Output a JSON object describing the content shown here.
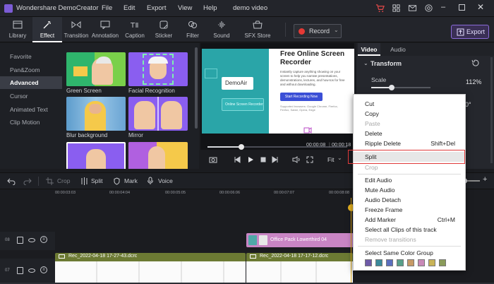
{
  "app": {
    "name": "Wondershare DemoCreator",
    "menus": [
      "File",
      "Edit",
      "Export",
      "View",
      "Help"
    ],
    "project_title": "demo video"
  },
  "toolbar": {
    "tools": [
      "Library",
      "Effect",
      "Transition",
      "Annotation",
      "Caption",
      "Sticker",
      "Filter",
      "Sound",
      "SFX Store"
    ],
    "active": "Effect",
    "record_label": "Record",
    "export_label": "Export"
  },
  "left_nav": {
    "items": [
      "Favorite",
      "Pan&Zoom",
      "Advanced",
      "Cursor",
      "Animated Text",
      "Clip Motion"
    ],
    "active": "Advanced"
  },
  "effects": {
    "tiles": [
      "Green Screen",
      "Facial Recognition",
      "Blur background",
      "Mirror"
    ]
  },
  "preview": {
    "headline": "Free Online Screen Recorder",
    "body": "Instantly capture anything showing on your screen to help you narrate presentations, demonstrations, lectures, and how-tos for free and without downloading.",
    "cta": "Start Recording Now",
    "supported": "Supported browsers: Google Chrome, Firefox, Firefox, Safari, Opera, Edge",
    "logo": "DemoAir",
    "small_text": "Online Screen Recorder",
    "time_current": "00:00:08",
    "time_total": "00:00:18",
    "fit_label": "Fit"
  },
  "right_panel": {
    "tabs": [
      "Video",
      "Audio"
    ],
    "active_tab": "Video",
    "section": "Transform",
    "scale_label": "Scale",
    "scale_value": "112%",
    "scale_fraction": 0.2,
    "rotate_value_partial": "0°"
  },
  "timeline": {
    "tools": [
      "Crop",
      "Split",
      "Mark",
      "Voice"
    ],
    "ruler": [
      "00:00:03:03",
      "00:00:04:04",
      "00:00:05:05",
      "00:00:06:06",
      "00:00:07:07",
      "00:00:08:08"
    ],
    "tracks": [
      {
        "number": "08",
        "clips": [
          {
            "name": "Office Pack Lowerthird 04"
          }
        ]
      },
      {
        "number": "07",
        "clips": [
          {
            "name": "Rec_2022-04-18 17-27-43.dcrc"
          },
          {
            "name": "Rec_2022-04-18 17-17-12.dcrc"
          }
        ]
      }
    ]
  },
  "context_menu": {
    "items": [
      {
        "label": "Cut",
        "enabled": true
      },
      {
        "label": "Copy",
        "enabled": true
      },
      {
        "label": "Paste",
        "enabled": false
      },
      {
        "label": "Delete",
        "enabled": true
      },
      {
        "label": "Ripple Delete",
        "enabled": true,
        "shortcut": "Shift+Del"
      },
      {
        "label": "Split",
        "enabled": true,
        "highlighted": true
      },
      {
        "label": "Crop",
        "enabled": false
      },
      {
        "label": "Edit Audio",
        "enabled": true
      },
      {
        "label": "Mute Audio",
        "enabled": true
      },
      {
        "label": "Audio Detach",
        "enabled": true
      },
      {
        "label": "Freeze Frame",
        "enabled": true
      },
      {
        "label": "Add Marker",
        "enabled": true,
        "shortcut": "Ctrl+M"
      },
      {
        "label": "Select all Clips of this track",
        "enabled": true
      },
      {
        "label": "Remove transitions",
        "enabled": false
      },
      {
        "label": "Select Same Color Group",
        "enabled": true
      }
    ],
    "color_swatches": [
      "#6e5aa8",
      "#3b8a9b",
      "#5b6fbf",
      "#58a08a",
      "#c79a66",
      "#c98ab8",
      "#c9b458",
      "#8a9b5a"
    ]
  },
  "colors": {
    "accent_purple": "#8b6bd9",
    "record_red": "#e53935",
    "highlight_red": "#e03a3a",
    "clip_pink": "#c985c4",
    "clip_olive": "#6c7a33"
  }
}
